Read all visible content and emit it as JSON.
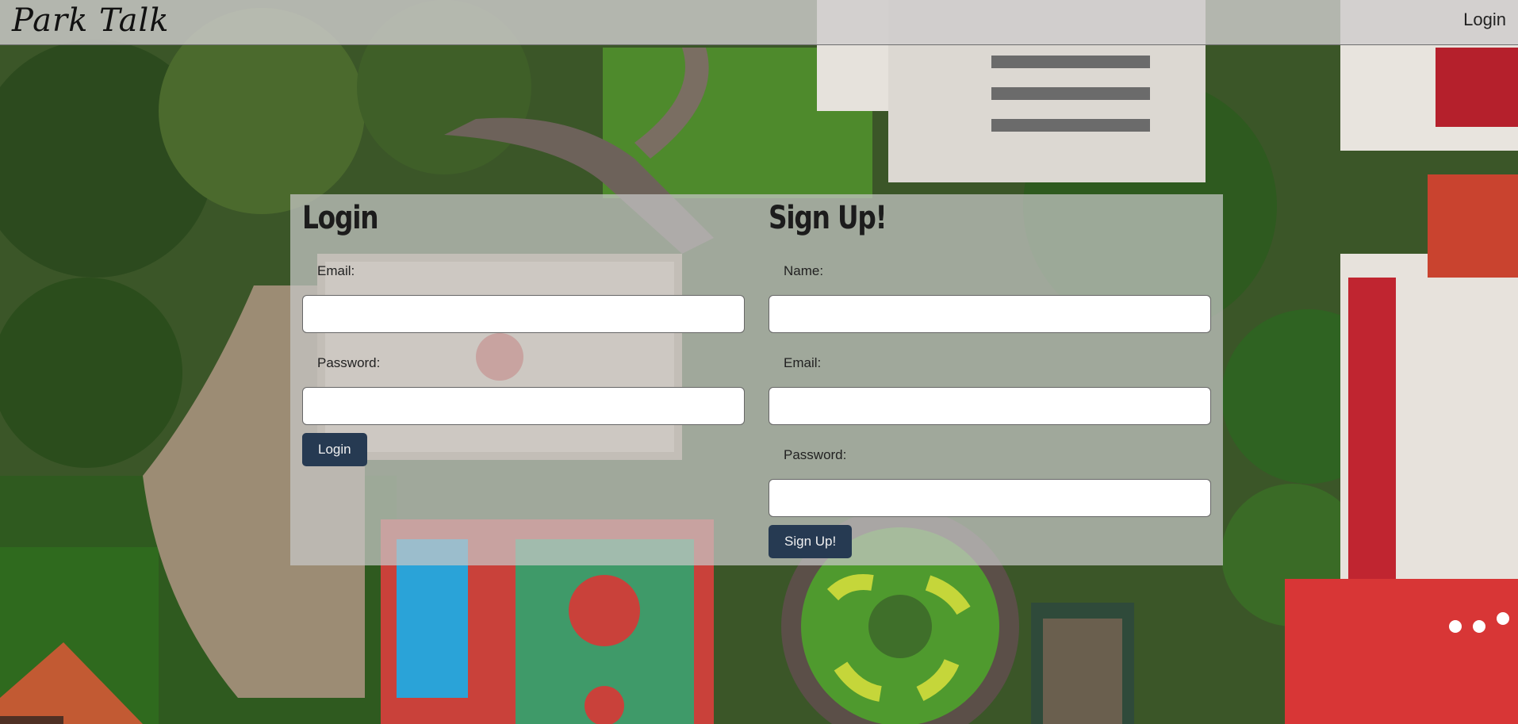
{
  "header": {
    "brand": "Park Talk",
    "nav_login": "Login"
  },
  "login": {
    "title": "Login",
    "email_label": "Email:",
    "email_value": "",
    "password_label": "Password:",
    "password_value": "",
    "submit_label": "Login"
  },
  "signup": {
    "title": "Sign Up!",
    "name_label": "Name:",
    "name_value": "",
    "email_label": "Email:",
    "email_value": "",
    "password_label": "Password:",
    "password_value": "",
    "submit_label": "Sign Up!"
  },
  "colors": {
    "button": "#263a52",
    "header_overlay": "#cecccc",
    "panel_overlay": "#c8c8c8"
  }
}
